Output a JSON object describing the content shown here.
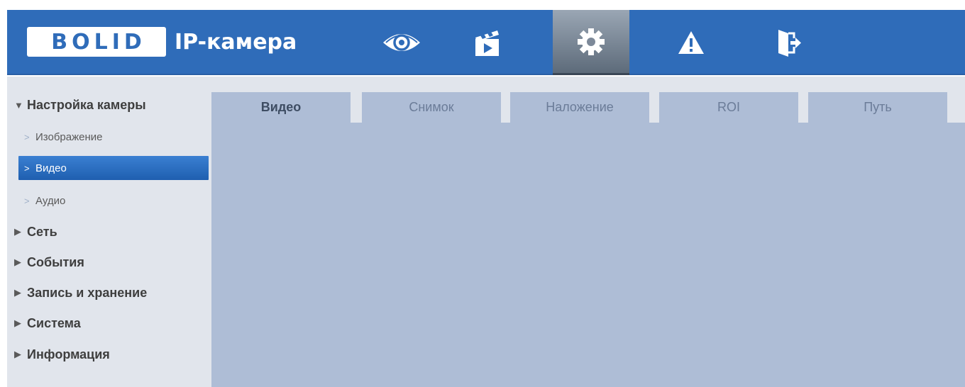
{
  "header": {
    "logo": "BOLID",
    "title": "IP-камера"
  },
  "nav": [
    {
      "name": "live-view",
      "icon": "eye-icon"
    },
    {
      "name": "playback",
      "icon": "clapperboard-icon"
    },
    {
      "name": "setup",
      "icon": "gear-icon",
      "active": true
    },
    {
      "name": "alarm",
      "icon": "warning-icon"
    },
    {
      "name": "logout",
      "icon": "exit-icon"
    }
  ],
  "sidebar": {
    "items": [
      {
        "label": "Настройка камеры",
        "type": "section",
        "expanded": true
      },
      {
        "label": "Изображение",
        "type": "sub"
      },
      {
        "label": "Видео",
        "type": "sub",
        "active": true
      },
      {
        "label": "Аудио",
        "type": "sub"
      },
      {
        "label": "Сеть",
        "type": "section"
      },
      {
        "label": "События",
        "type": "section"
      },
      {
        "label": "Запись и хранение",
        "type": "section"
      },
      {
        "label": "Система",
        "type": "section"
      },
      {
        "label": "Информация",
        "type": "section"
      }
    ]
  },
  "tabs": [
    {
      "label": "Видео",
      "active": true
    },
    {
      "label": "Снимок"
    },
    {
      "label": "Наложение"
    },
    {
      "label": "ROI"
    },
    {
      "label": "Путь"
    }
  ],
  "colors": {
    "header": "#2f6cb9",
    "sidebar": "#e1e5ec",
    "content": "#aebdd6",
    "active_item": "#2a6cc4"
  }
}
